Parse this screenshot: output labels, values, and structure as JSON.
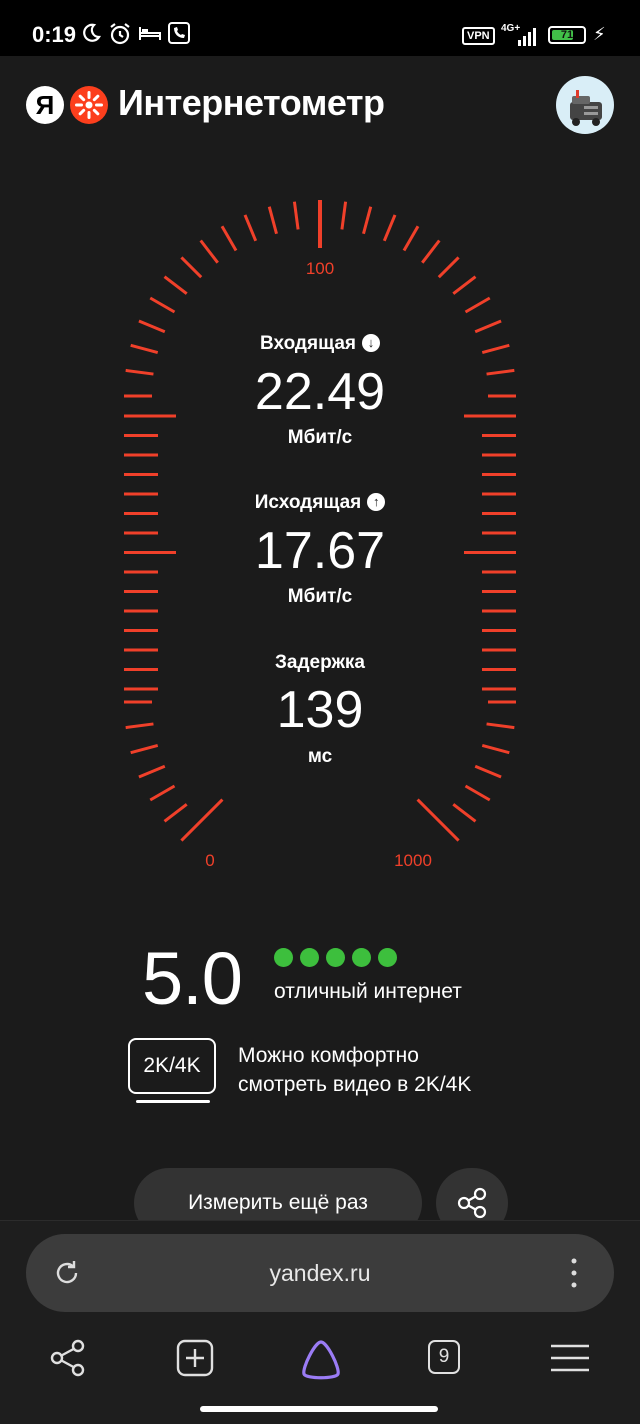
{
  "status_bar": {
    "time": "0:19",
    "vpn": "VPN",
    "network": "4G+",
    "battery_percent": "71",
    "battery_level": 0.71,
    "icons": [
      "moon-icon",
      "alarm-icon",
      "bed-icon",
      "phone-icon",
      "signal-icon",
      "charging-icon"
    ]
  },
  "header": {
    "logo_letter": "Я",
    "title": "Интернетометр"
  },
  "gauge": {
    "tick_labels": {
      "top": "100",
      "left": "0",
      "right": "1000"
    },
    "download": {
      "label": "Входящая",
      "value": "22.49",
      "unit": "Мбит/с"
    },
    "upload": {
      "label": "Исходящая",
      "value": "17.67",
      "unit": "Мбит/с"
    },
    "latency": {
      "label": "Задержка",
      "value": "139",
      "unit": "мс"
    },
    "accent_color": "#f0402a"
  },
  "rating": {
    "score": "5.0",
    "dots_total": 5,
    "dots_filled": 5,
    "dot_color": "#3dbf3d",
    "text": "отличный интернет"
  },
  "quality": {
    "badge": "2K/4K",
    "line1": "Можно комфортно",
    "line2": "смотреть видео в 2K/4K"
  },
  "actions": {
    "measure_again": "Измерить ещё раз"
  },
  "browser": {
    "url": "yandex.ru",
    "tab_count": "9"
  }
}
